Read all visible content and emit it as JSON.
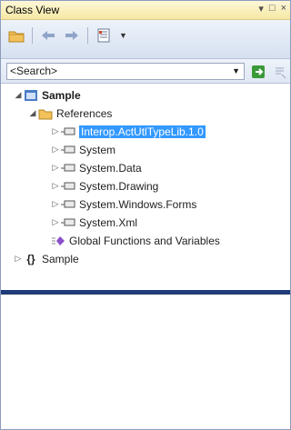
{
  "titlebar": {
    "title": "Class View",
    "pin_glyph": "▾",
    "max_glyph": "□",
    "close_glyph": "×"
  },
  "toolbar": {
    "icons": [
      "folder-icon",
      "back-arrow-icon",
      "forward-arrow-icon",
      "settings-list-icon"
    ]
  },
  "search": {
    "value": "<Search>"
  },
  "tree": {
    "root": "Sample",
    "references": "References",
    "items": [
      "Interop.ActUtlTypeLib.1.0",
      "System",
      "System.Data",
      "System.Drawing",
      "System.Windows.Forms",
      "System.Xml"
    ],
    "globals": "Global Functions and Variables",
    "namespace": "Sample"
  },
  "colors": {
    "selection": "#3399ff",
    "splitter": "#1f3c78",
    "title_bg": "#f6e8a3"
  }
}
